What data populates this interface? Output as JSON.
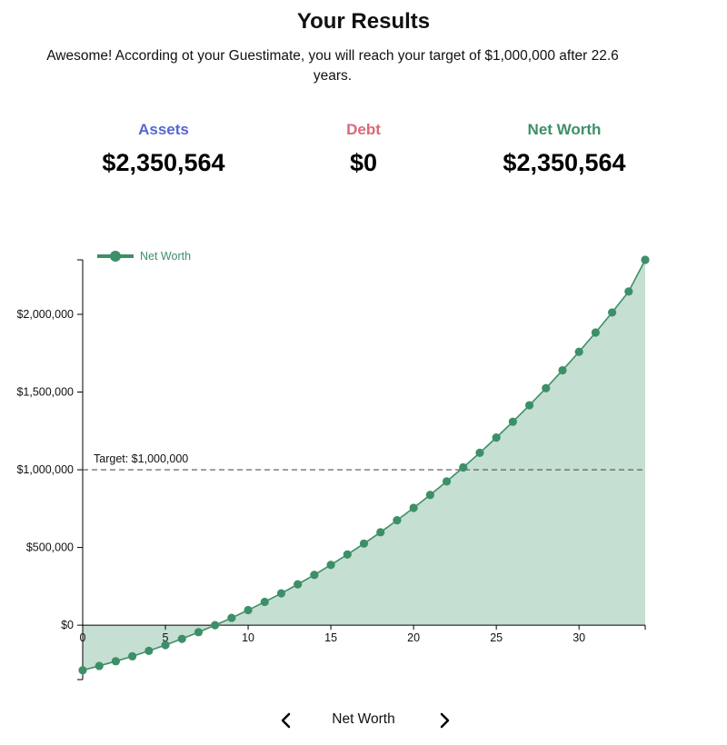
{
  "header": {
    "title": "Your Results",
    "subtitle": "Awesome! According ot your Guestimate, you will reach your target of $1,000,000 after 22.6 years."
  },
  "stats": {
    "assets": {
      "label": "Assets",
      "value": "$2,350,564",
      "color": "#5567d0"
    },
    "debt": {
      "label": "Debt",
      "value": "$0",
      "color": "#d9697a"
    },
    "net_worth": {
      "label": "Net Worth",
      "value": "$2,350,564",
      "color": "#3d8f68"
    }
  },
  "chart_data": {
    "type": "area",
    "series": [
      {
        "name": "Net Worth",
        "color": "#3d8f68",
        "fill": "#c5dfd2",
        "x": [
          0,
          1,
          2,
          3,
          4,
          5,
          6,
          7,
          8,
          9,
          10,
          11,
          12,
          13,
          14,
          15,
          16,
          17,
          18,
          19,
          20,
          21,
          22,
          23,
          24,
          25,
          26,
          27,
          28,
          29,
          30,
          31,
          32,
          33,
          34
        ],
        "values": [
          -290000,
          -262000,
          -232000,
          -200000,
          -165000,
          -128000,
          -88000,
          -45000,
          0,
          47000,
          97000,
          150000,
          205000,
          263000,
          324000,
          388000,
          455000,
          525000,
          598000,
          675000,
          755000,
          838000,
          925000,
          1015000,
          1109000,
          1207000,
          1309000,
          1415000,
          1525000,
          1640000,
          1759000,
          1883000,
          2012000,
          2147000,
          2350564
        ]
      }
    ],
    "xticks": [
      0,
      5,
      10,
      15,
      20,
      25,
      30
    ],
    "yticks": [
      0,
      500000,
      1000000,
      1500000,
      2000000
    ],
    "ytick_labels": [
      "$0",
      "$500,000",
      "$1,000,000",
      "$1,500,000",
      "$2,000,000"
    ],
    "xlim": [
      0,
      34
    ],
    "ylim": [
      -350000,
      2350564
    ],
    "target": {
      "value": 1000000,
      "label": "Target: $1,000,000"
    },
    "legend": {
      "label": "Net Worth",
      "placement": "top-left"
    },
    "grid": false
  },
  "footer": {
    "label": "Net Worth",
    "prev_icon": "chevron-left-icon",
    "next_icon": "chevron-right-icon"
  }
}
